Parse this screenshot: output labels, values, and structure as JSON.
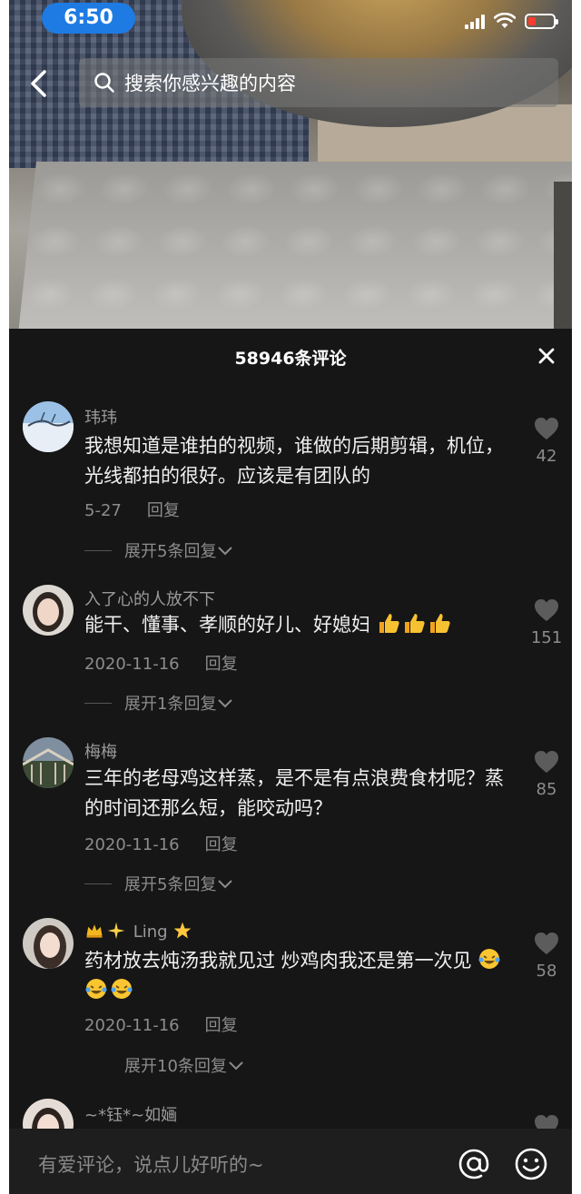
{
  "status_bar": {
    "time": "6:50",
    "battery_level": 0.25,
    "battery_color": "#ff3b30"
  },
  "search": {
    "placeholder": "搜索你感兴趣的内容"
  },
  "comments_panel": {
    "title": "58946条评论",
    "comments": [
      {
        "username": "玮玮",
        "text": "我想知道是谁拍的视频，谁做的后期剪辑，机位，光线都拍的很好。应该是有团队的",
        "date": "5-27",
        "reply_label": "回复",
        "expand_label": "展开5条回复",
        "likes": "42"
      },
      {
        "username": "入了心的人放不下",
        "text": "能干、懂事、孝顺的好儿、好媳妇",
        "emojis": [
          "thumbs-up",
          "thumbs-up",
          "thumbs-up"
        ],
        "date": "2020-11-16",
        "reply_label": "回复",
        "expand_label": "展开1条回复",
        "likes": "151"
      },
      {
        "username": "梅梅",
        "text": "三年的老母鸡这样蒸，是不是有点浪费食材呢？蒸的时间还那么短，能咬动吗？",
        "date": "2020-11-16",
        "reply_label": "回复",
        "expand_label": "展开5条回复",
        "likes": "85"
      },
      {
        "username": "Ling",
        "username_emojis": [
          "crown",
          "sparkles",
          "star"
        ],
        "text": "药材放去炖汤我就见过 炒鸡肉我还是第一次见",
        "emojis": [
          "laughing-tears",
          "laughing-tears",
          "laughing-tears"
        ],
        "date": "2020-11-16",
        "reply_label": "回复",
        "expand_label": "展开10条回复",
        "likes": "58"
      },
      {
        "username": "~*钰*~如婳"
      }
    ]
  },
  "input_bar": {
    "placeholder": "有爱评论，说点儿好听的~"
  },
  "icons": [
    "back-arrow-icon",
    "search-icon",
    "close-icon",
    "heart-icon",
    "chevron-down-icon",
    "at-icon",
    "emoji-icon"
  ]
}
